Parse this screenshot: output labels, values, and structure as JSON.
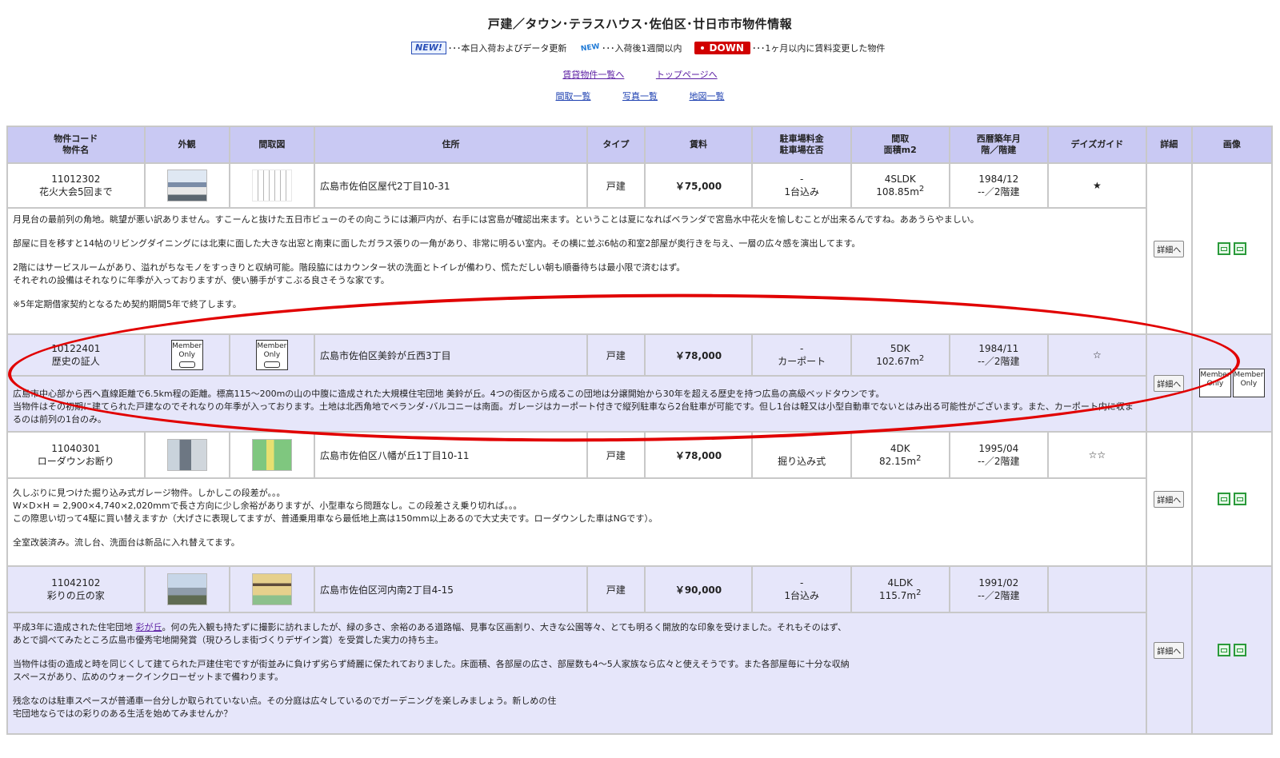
{
  "page_title": "戸建／タウン･テラスハウス･佐伯区･廿日市市物件情報",
  "legend": {
    "new_badge": "NEW!",
    "new_text": "･･･本日入荷およびデータ更新",
    "new2_badge": "NEW",
    "new2_text": "･･･入荷後1週間以内",
    "down_badge": "DOWN",
    "down_text": "･･･1ヶ月以内に賃料変更した物件"
  },
  "links_row1": [
    "賃貸物件一覧へ",
    "トップページへ"
  ],
  "links_row2": [
    "間取一覧",
    "写真一覧",
    "地図一覧"
  ],
  "headers": {
    "code": [
      "物件コード",
      "物件名"
    ],
    "exterior": "外観",
    "floorplan": "間取図",
    "address": "住所",
    "type": "タイプ",
    "rent": "賃料",
    "parking": [
      "駐車場料金",
      "駐車場在否"
    ],
    "layout": [
      "間取",
      "面積m2"
    ],
    "built": [
      "西暦築年月",
      "階／階建"
    ],
    "guide": "デイズガイド",
    "detail": "詳細",
    "image": "画像"
  },
  "detail_button": "詳細へ",
  "member_only": [
    "Member",
    "Only"
  ],
  "listings": [
    {
      "code": "11012302",
      "name": "花火大会5回まで",
      "address": "広島市佐伯区屋代2丁目10-31",
      "type": "戸建",
      "rent": "￥75,000",
      "parking_fee": "-",
      "parking": "1台込み",
      "layout": "4SLDK",
      "area": "108.85m",
      "built": "1984/12",
      "floors": "--／2階建",
      "guide": "★",
      "desc": [
        "月見台の最前列の角地。眺望が悪い訳ありません。すこーんと抜けた五日市ビューのその向こうには瀬戸内が、右手には宮島が確認出来ます。ということは夏になればベランダで宮島水中花火を愉しむことが出来るんですね。ああうらやましい。",
        "部屋に目を移すと14帖のリビングダイニングには北東に面した大きな出窓と南東に面したガラス張りの一角があり、非常に明るい室内。その横に並ぶ6帖の和室2部屋が奥行きを与え、一層の広々感を演出してます。",
        "2階にはサービスルームがあり、溢れがちなモノをすっきりと収納可能。階段脇にはカウンター状の洗面とトイレが備わり、慌ただしい朝も順番待ちは最小限で済むはず。\nそれぞれの設備はそれなりに年季が入っておりますが、使い勝手がすこぶる良さそうな家です。",
        "※5年定期借家契約となるため契約期間5年で終了します。"
      ]
    },
    {
      "code": "10122401",
      "name": "歴史の証人",
      "address": "広島市佐伯区美鈴が丘西3丁目",
      "type": "戸建",
      "rent": "￥78,000",
      "parking_fee": "-",
      "parking": "カーポート",
      "layout": "5DK",
      "area": "102.67m",
      "built": "1984/11",
      "floors": "--／2階建",
      "guide": "☆",
      "desc": [
        "広島市中心部から西へ直線距離で6.5km程の距離。標高115～200mの山の中腹に造成された大規模住宅団地 美鈴が丘。4つの街区から成るこの団地は分譲開始から30年を超える歴史を持つ広島の高級ベッドタウンです。\n当物件はその初期に建てられた戸建なのでそれなりの年季が入っております。土地は北西角地でベランダ･バルコニーは南面。ガレージはカーポート付きで縦列駐車なら2台駐車が可能です。但し1台は軽又は小型自動車でないとはみ出る可能性がございます。また、カーポート内に収まるのは前列の1台のみ。"
      ]
    },
    {
      "code": "11040301",
      "name": "ローダウンお断り",
      "address": "広島市佐伯区八幡が丘1丁目10-11",
      "type": "戸建",
      "rent": "￥78,000",
      "parking_fee": "",
      "parking": "掘り込み式",
      "layout": "4DK",
      "area": "82.15m",
      "built": "1995/04",
      "floors": "--／2階建",
      "guide": "☆☆",
      "desc": [
        "久しぶりに見つけた掘り込み式ガレージ物件。しかしこの段差が。。。\nW×D×H = 2,900×4,740×2,020mmで長さ方向に少し余裕がありますが、小型車なら問題なし。この段差さえ乗り切れば。。。\nこの際思い切って4駆に買い替えますか（大げさに表現してますが、普通乗用車なら最低地上高は150mm以上あるので大丈夫です。ローダウンした車はNGです）。",
        "全室改装済み。流し台、洗面台は新品に入れ替えてます。"
      ]
    },
    {
      "code": "11042102",
      "name": "彩りの丘の家",
      "address": "広島市佐伯区河内南2丁目4-15",
      "type": "戸建",
      "rent": "￥90,000",
      "parking_fee": "-",
      "parking": "1台込み",
      "layout": "4LDK",
      "area": "115.7m",
      "built": "1991/02",
      "floors": "--／2階建",
      "guide": "",
      "desc_link": "彩が丘",
      "desc_pre": "平成3年に造成された住宅団地 ",
      "desc_post": "。何の先入観も持たずに撮影に訪れましたが、緑の多さ、余裕のある道路幅、見事な区画割り、大きな公園等々、とても明るく開放的な印象を受けました。それもそのはず、\nあとで調べてみたところ広島市優秀宅地開発賞（現ひろしま街づくりデザイン賞）を受賞した実力の持ち主。",
      "desc": [
        "当物件は街の造成と時を同じくして建てられた戸建住宅ですが街並みに負けず劣らず綺麗に保たれておりました。床面積、各部屋の広さ、部屋数も4～5人家族なら広々と使えそうです。また各部屋毎に十分な収納\nスペースがあり、広めのウォークインクローゼットまで備わります。",
        "残念なのは駐車スペースが普通車一台分しか取られていない点。その分庭は広々しているのでガーデニングを楽しみましょう。新しめの住\n宅団地ならではの彩りのある生活を始めてみませんか？"
      ]
    }
  ],
  "colors": {
    "header_bg": "#c9c9f3",
    "alt_row_bg": "#e6e6fa",
    "annotation": "#e10000",
    "down_badge": "#d10000"
  }
}
